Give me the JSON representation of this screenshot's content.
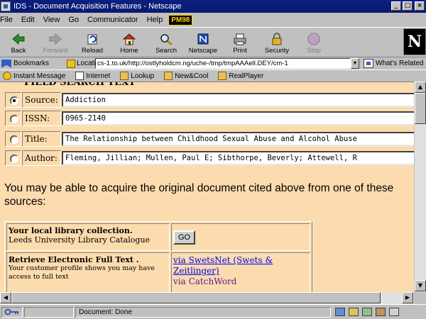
{
  "window": {
    "title": "IDS - Document Acquisition Features - Netscape",
    "buttons": {
      "minimize": "_",
      "maximize": "□",
      "close": "×"
    }
  },
  "menubar": {
    "items": [
      "File",
      "Edit",
      "View",
      "Go",
      "Communicator",
      "Help"
    ],
    "badge": "PM98"
  },
  "toolbar": {
    "buttons": [
      {
        "label": "Back",
        "icon": "back-arrow-icon",
        "enabled": true
      },
      {
        "label": "Forward",
        "icon": "forward-arrow-icon",
        "enabled": false
      },
      {
        "label": "Reload",
        "icon": "reload-icon",
        "enabled": true
      },
      {
        "label": "Home",
        "icon": "home-icon",
        "enabled": true
      },
      {
        "label": "Search",
        "icon": "search-icon",
        "enabled": true
      },
      {
        "label": "Netscape",
        "icon": "netscape-icon",
        "enabled": true
      },
      {
        "label": "Print",
        "icon": "print-icon",
        "enabled": true
      },
      {
        "label": "Security",
        "icon": "security-lock-icon",
        "enabled": true
      },
      {
        "label": "Stop",
        "icon": "stop-icon",
        "enabled": false
      }
    ],
    "logo": "N"
  },
  "location": {
    "bookmarks_label": "Bookmarks",
    "location_label": "Location:",
    "url": "cs-1.to.uk/http://ostlyholdcm.ng/uche-/tmp/tmpAAAell.DEY/cm-1",
    "related_label": "What's Related"
  },
  "personal_toolbar": {
    "items": [
      "Instant Message",
      "Internet",
      "Lookup",
      "New&Cool",
      "RealPlayer"
    ]
  },
  "content": {
    "heading": "FIELD SEARCH TEXT",
    "fields": [
      {
        "label": "Source:",
        "value": "Addiction",
        "checked": true
      },
      {
        "label": "ISSN:",
        "value": "0965-2140",
        "checked": false
      },
      {
        "label": "Title:",
        "value": "The Relationship between Childhood Sexual Abuse and Alcohol Abuse",
        "checked": false
      },
      {
        "label": "Author:",
        "value": "Fleming, Jillian; Mullen, Paul E; Sibthorpe, Beverly; Attewell, R",
        "checked": false
      }
    ],
    "intro": "You may be able to acquire the original document cited above from one of these sources:",
    "sources": {
      "local": {
        "title": "Your local library collection.",
        "subtitle": "Leeds University Library Catalogue",
        "button": "GO"
      },
      "electronic": {
        "title": "Retrieve Electronic Full Text .",
        "note": "Your customer profile shows you may have access to full text",
        "link1": "via SwetsNet (Swets & Zeitlinger)",
        "link2": "via CatchWord"
      }
    }
  },
  "status": {
    "text": "Document: Done"
  }
}
